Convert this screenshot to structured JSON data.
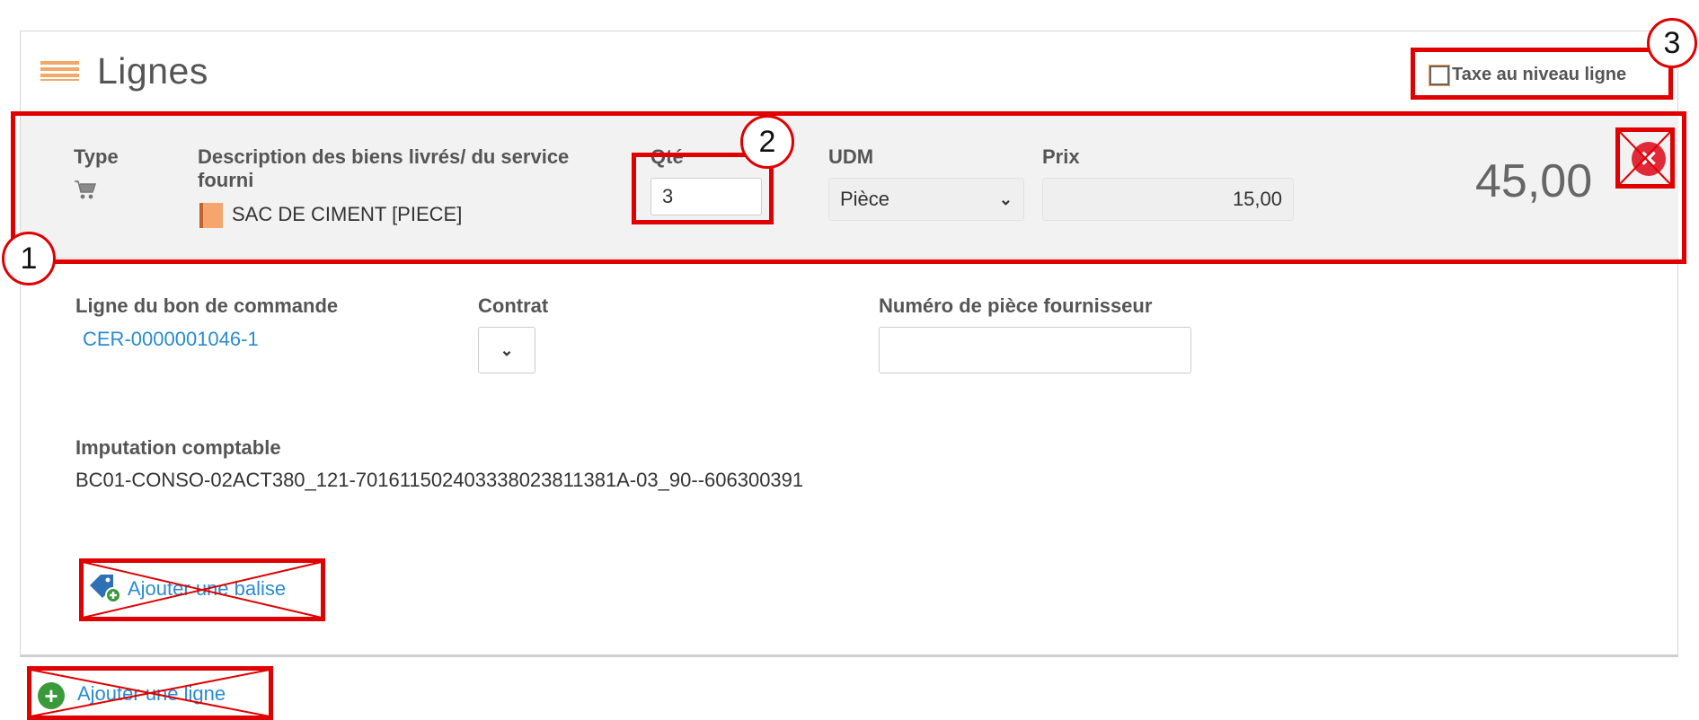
{
  "header": {
    "title": "Lignes",
    "tax_checkbox_label": "Taxe au niveau ligne"
  },
  "line": {
    "type_label": "Type",
    "description_label": "Description des biens livrés/ du service fourni",
    "product_name": "SAC DE CIMENT [PIECE]",
    "qty_label": "Qté",
    "qty_value": "3",
    "uom_label": "UDM",
    "uom_value": "Pièce",
    "price_label": "Prix",
    "price_value": "15,00",
    "total": "45,00"
  },
  "details": {
    "po_line_label": "Ligne du bon de commande",
    "po_line_value": "CER-0000001046-1",
    "contract_label": "Contrat",
    "supplier_part_label": "Numéro de pièce fournisseur",
    "supplier_part_value": "",
    "accounting_label": "Imputation comptable",
    "accounting_value": "BC01-CONSO-02ACT380_121-701611502403338023811381A-03_90--606300391"
  },
  "actions": {
    "add_tag": "Ajouter une balise",
    "add_line": "Ajouter une ligne"
  },
  "annotations": {
    "badge1": "1",
    "badge2": "2",
    "badge3": "3"
  },
  "colors": {
    "highlight": "#e00000",
    "link": "#2a8bd1",
    "accent": "#f2a868",
    "delete": "#e02a3a",
    "add": "#3a9a3a"
  },
  "icons": {
    "header": "lines-icon",
    "type": "cart-icon",
    "product": "product-icon",
    "delete": "delete-icon",
    "tag": "tag-icon",
    "add": "plus-circle-icon"
  }
}
